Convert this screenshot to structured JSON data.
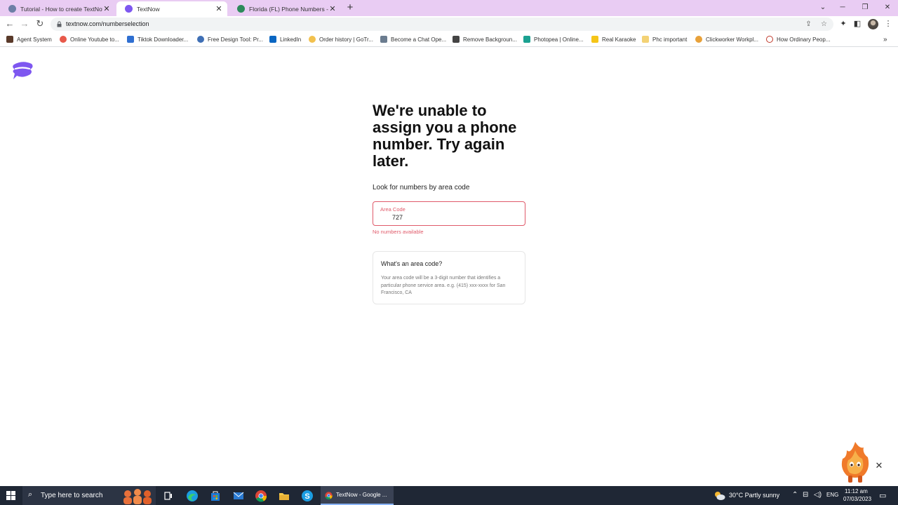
{
  "browser": {
    "tabs": [
      {
        "title": "Tutorial - How to create TextNow",
        "active": false
      },
      {
        "title": "TextNow",
        "active": true
      },
      {
        "title": "Florida (FL) Phone Numbers - Lo",
        "active": false
      }
    ],
    "url": "textnow.com/numberselection"
  },
  "bookmarks": [
    "Agent System",
    "Online Youtube to...",
    "Tiktok Downloader...",
    "Free Design Tool: Pr...",
    "LinkedIn",
    "Order history | GoTr...",
    "Become a Chat Ope...",
    "Remove Backgroun...",
    "Photopea | Online...",
    "Real Karaoke",
    "Phc important",
    "Clickworker Workpl...",
    "How Ordinary Peop..."
  ],
  "page": {
    "headline": "We're unable to assign you a phone number. Try again later.",
    "area_code_prompt": "Look for numbers by area code",
    "field_label": "Area Code",
    "field_value": "727",
    "error": "No numbers available",
    "info_title": "What's an area code?",
    "info_body": "Your area code will be a 3-digit number that identifies a particular phone service area. e.g. (415) xxx-xxxx for San Francisco, CA"
  },
  "taskbar": {
    "search_placeholder": "Type here to search",
    "active_window": "TextNow - Google ...",
    "weather": "30°C  Partly sunny",
    "language": "ENG",
    "time": "11:12 am",
    "date": "07/03/2023"
  },
  "colors": {
    "brand": "#7e57f0",
    "error": "#e05a6a",
    "tab_strip": "#e9ccf3"
  }
}
